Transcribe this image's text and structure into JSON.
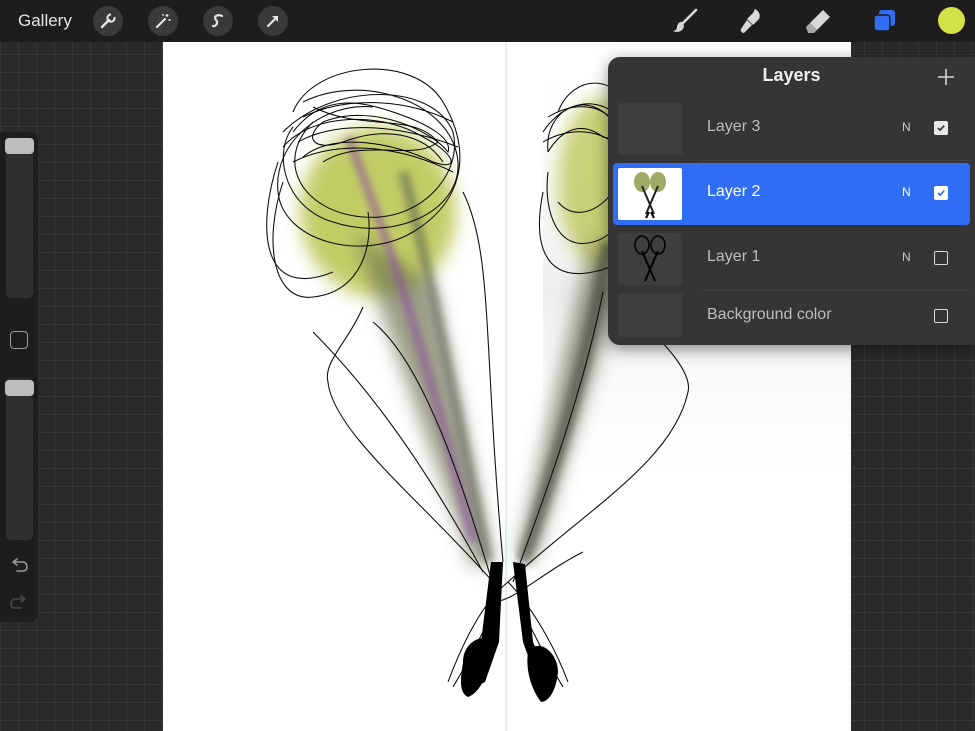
{
  "toolbar": {
    "gallery_label": "Gallery",
    "left_tools": [
      "wrench-icon",
      "magic-wand-icon",
      "selection-s-icon",
      "transform-arrow-icon"
    ],
    "right_tools": [
      "brush-icon",
      "smudge-icon",
      "eraser-icon",
      "layers-icon"
    ],
    "current_color": "#d3e147",
    "active_tool_color": "#2f6ef2"
  },
  "sidebar": {
    "size_slider_level": 1.0,
    "opacity_slider_level": 1.0,
    "icons": [
      "modify-square-icon",
      "undo-icon",
      "redo-icon"
    ]
  },
  "layers_panel": {
    "title": "Layers",
    "add_icon": "plus-icon",
    "layers": [
      {
        "name": "Layer 3",
        "blend": "N",
        "visible": true,
        "selected": false
      },
      {
        "name": "Layer 2",
        "blend": "N",
        "visible": true,
        "selected": true
      },
      {
        "name": "Layer 1",
        "blend": "N",
        "visible": false,
        "selected": false
      },
      {
        "name": "Background color",
        "blend": "",
        "visible": false,
        "selected": false
      }
    ]
  },
  "canvas": {
    "background": "#ffffff",
    "stroke_colors": [
      "#000000",
      "#b4c640",
      "#8a5a9a"
    ]
  }
}
